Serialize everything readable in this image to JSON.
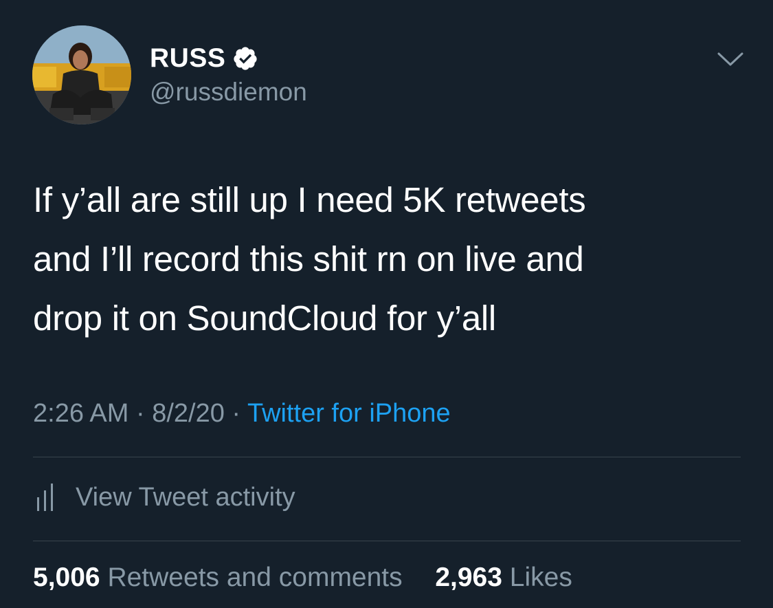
{
  "tweet": {
    "author": {
      "display_name": "RUSS",
      "handle": "@russdiemon",
      "verified": true
    },
    "text": "If y’all are still up I need 5K retweets\nand I’ll record this shit rn on live and\ndrop it on SoundCloud for y’all",
    "time": "2:26 AM",
    "date": "8/2/20",
    "separator": "·",
    "source": "Twitter for iPhone",
    "activity_label": "View Tweet activity",
    "stats": {
      "retweets_count": "5,006",
      "retweets_label": "Retweets and comments",
      "likes_count": "2,963",
      "likes_label": "Likes"
    }
  },
  "colors": {
    "background": "#15202b",
    "primary_text": "#ffffff",
    "secondary_text": "#8899a6",
    "link": "#1da1f2",
    "divider": "#38444d"
  },
  "icons": {
    "verified": "verified-badge-icon",
    "more": "chevron-down-icon",
    "activity": "bar-chart-icon"
  }
}
